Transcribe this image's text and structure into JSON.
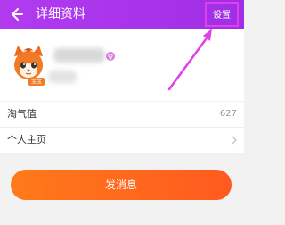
{
  "header": {
    "title": "详细资料",
    "settings_label": "设置",
    "bg_color": "#b23bf0"
  },
  "profile": {
    "avatar_badge": "宝宝"
  },
  "rows": [
    {
      "label": "淘气值",
      "value": "627"
    },
    {
      "label": "个人主页",
      "value": ""
    }
  ],
  "actions": {
    "send_label": "发消息",
    "send_color": "#ff6a1f"
  },
  "annotation": {
    "highlight_color": "#e040e8"
  }
}
